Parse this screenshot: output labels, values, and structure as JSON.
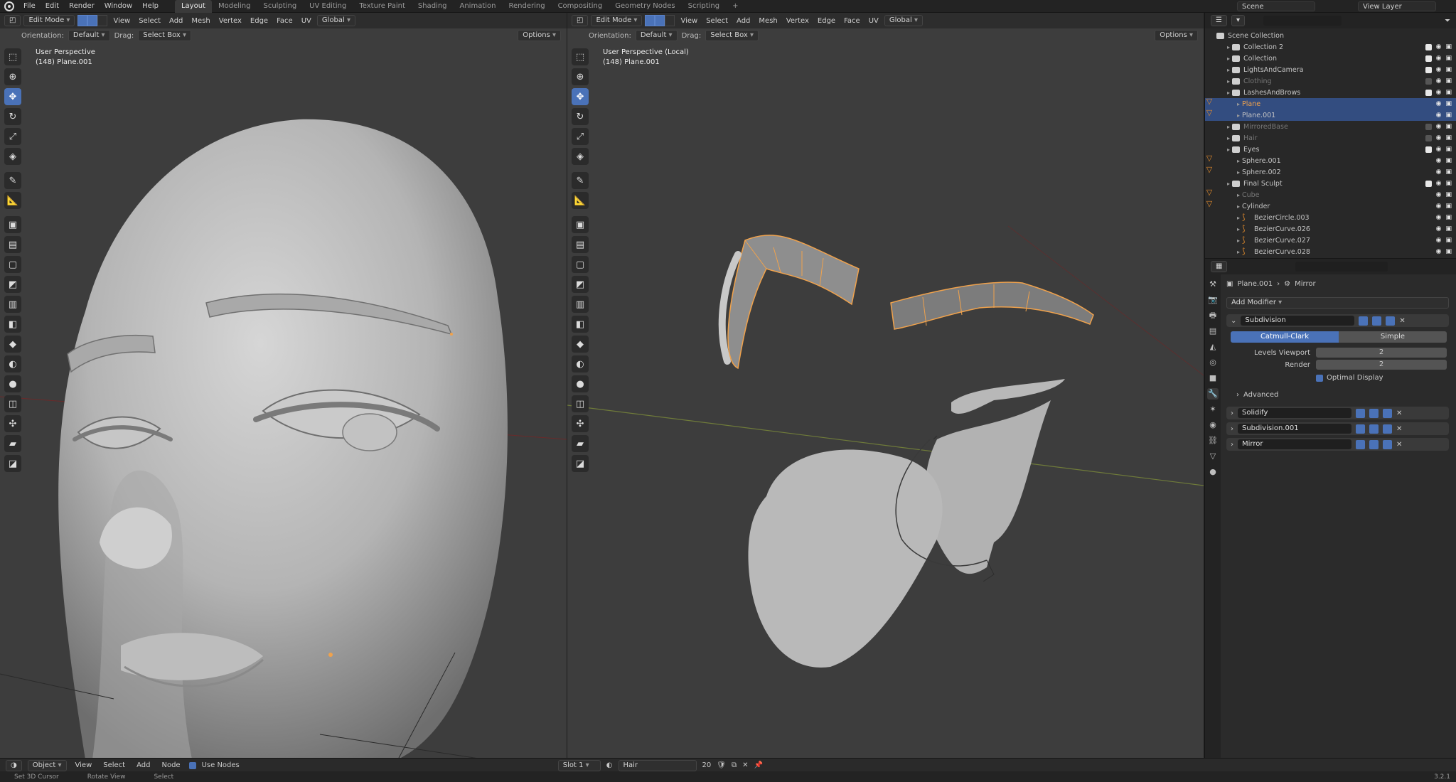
{
  "topbar": {
    "menus": [
      "File",
      "Edit",
      "Render",
      "Window",
      "Help"
    ],
    "workspaces": [
      "Layout",
      "Modeling",
      "Sculpting",
      "UV Editing",
      "Texture Paint",
      "Shading",
      "Animation",
      "Rendering",
      "Compositing",
      "Geometry Nodes",
      "Scripting"
    ],
    "active_workspace": "Layout",
    "scene": "Scene",
    "view_layer": "View Layer"
  },
  "viewport_left": {
    "mode": "Edit Mode",
    "menus": [
      "View",
      "Select",
      "Add",
      "Mesh",
      "Vertex",
      "Edge",
      "Face",
      "UV"
    ],
    "transform": "Global",
    "orientation_label": "Orientation:",
    "orientation": "Default",
    "drag_label": "Drag:",
    "drag": "Select Box",
    "options": "Options",
    "info_line1": "User Perspective",
    "info_line2": "(148) Plane.001"
  },
  "viewport_right": {
    "mode": "Edit Mode",
    "menus": [
      "View",
      "Select",
      "Add",
      "Mesh",
      "Vertex",
      "Edge",
      "Face",
      "UV"
    ],
    "transform": "Global",
    "orientation_label": "Orientation:",
    "orientation": "Default",
    "drag_label": "Drag:",
    "drag": "Select Box",
    "options": "Options",
    "info_line1": "User Perspective (Local)",
    "info_line2": "(148) Plane.001"
  },
  "outliner": {
    "root": "Scene Collection",
    "rows": [
      {
        "name": "Collection 2",
        "type": "coll",
        "indent": 1,
        "dim": false,
        "sel": false,
        "check": true
      },
      {
        "name": "Collection",
        "type": "coll",
        "indent": 1,
        "dim": false,
        "sel": false,
        "check": true
      },
      {
        "name": "LightsAndCamera",
        "type": "coll",
        "indent": 1,
        "dim": false,
        "sel": false,
        "check": true
      },
      {
        "name": "Clothing",
        "type": "coll",
        "indent": 1,
        "dim": true,
        "sel": false,
        "check": false
      },
      {
        "name": "LashesAndBrows",
        "type": "coll",
        "indent": 1,
        "dim": false,
        "sel": false,
        "check": true
      },
      {
        "name": "Plane",
        "type": "mesh",
        "indent": 2,
        "dim": false,
        "sel": true,
        "orange": true,
        "check": null
      },
      {
        "name": "Plane.001",
        "type": "mesh",
        "indent": 2,
        "dim": false,
        "sel": true,
        "orange": false,
        "check": null
      },
      {
        "name": "MirroredBase",
        "type": "coll",
        "indent": 1,
        "dim": true,
        "sel": false,
        "check": false
      },
      {
        "name": "Hair",
        "type": "coll",
        "indent": 1,
        "dim": true,
        "sel": false,
        "check": false
      },
      {
        "name": "Eyes",
        "type": "coll",
        "indent": 1,
        "dim": false,
        "sel": false,
        "check": true
      },
      {
        "name": "Sphere.001",
        "type": "mesh",
        "indent": 2,
        "dim": false,
        "sel": false,
        "check": null
      },
      {
        "name": "Sphere.002",
        "type": "mesh",
        "indent": 2,
        "dim": false,
        "sel": false,
        "check": null
      },
      {
        "name": "Final Sculpt",
        "type": "coll",
        "indent": 1,
        "dim": false,
        "sel": false,
        "check": true
      },
      {
        "name": "Cube",
        "type": "mesh",
        "indent": 2,
        "dim": true,
        "sel": false,
        "check": null
      },
      {
        "name": "Cylinder",
        "type": "mesh",
        "indent": 2,
        "dim": false,
        "sel": false,
        "check": null
      },
      {
        "name": "BezierCircle.003",
        "type": "curve",
        "indent": 2,
        "dim": false,
        "sel": false,
        "check": null
      },
      {
        "name": "BezierCurve.026",
        "type": "curve",
        "indent": 2,
        "dim": false,
        "sel": false,
        "check": null
      },
      {
        "name": "BezierCurve.027",
        "type": "curve",
        "indent": 2,
        "dim": false,
        "sel": false,
        "check": null
      },
      {
        "name": "BezierCurve.028",
        "type": "curve",
        "indent": 2,
        "dim": false,
        "sel": false,
        "check": null
      }
    ]
  },
  "properties": {
    "breadcrumb_object": "Plane.001",
    "breadcrumb_modifier": "Mirror",
    "add_modifier": "Add Modifier",
    "subdivision": {
      "name": "Subdivision",
      "tab_catmull": "Catmull-Clark",
      "tab_simple": "Simple",
      "levels_viewport_label": "Levels Viewport",
      "levels_viewport": "2",
      "render_label": "Render",
      "render": "2",
      "optimal_display": "Optimal Display",
      "advanced": "Advanced"
    },
    "modifiers": [
      "Solidify",
      "Subdivision.001",
      "Mirror"
    ]
  },
  "node_header": {
    "editor": "Object",
    "menus": [
      "View",
      "Select",
      "Add",
      "Node"
    ],
    "use_nodes": "Use Nodes",
    "slot": "Slot 1",
    "material": "Hair",
    "users": "20"
  },
  "statusbar": {
    "items": [
      "Set 3D Cursor",
      "Rotate View",
      "Select"
    ],
    "version": "3.2.1"
  },
  "colors": {
    "accent": "#4a72b8",
    "selection_orange": "#f0a24c",
    "viewport_bg": "#3d3d3d"
  }
}
